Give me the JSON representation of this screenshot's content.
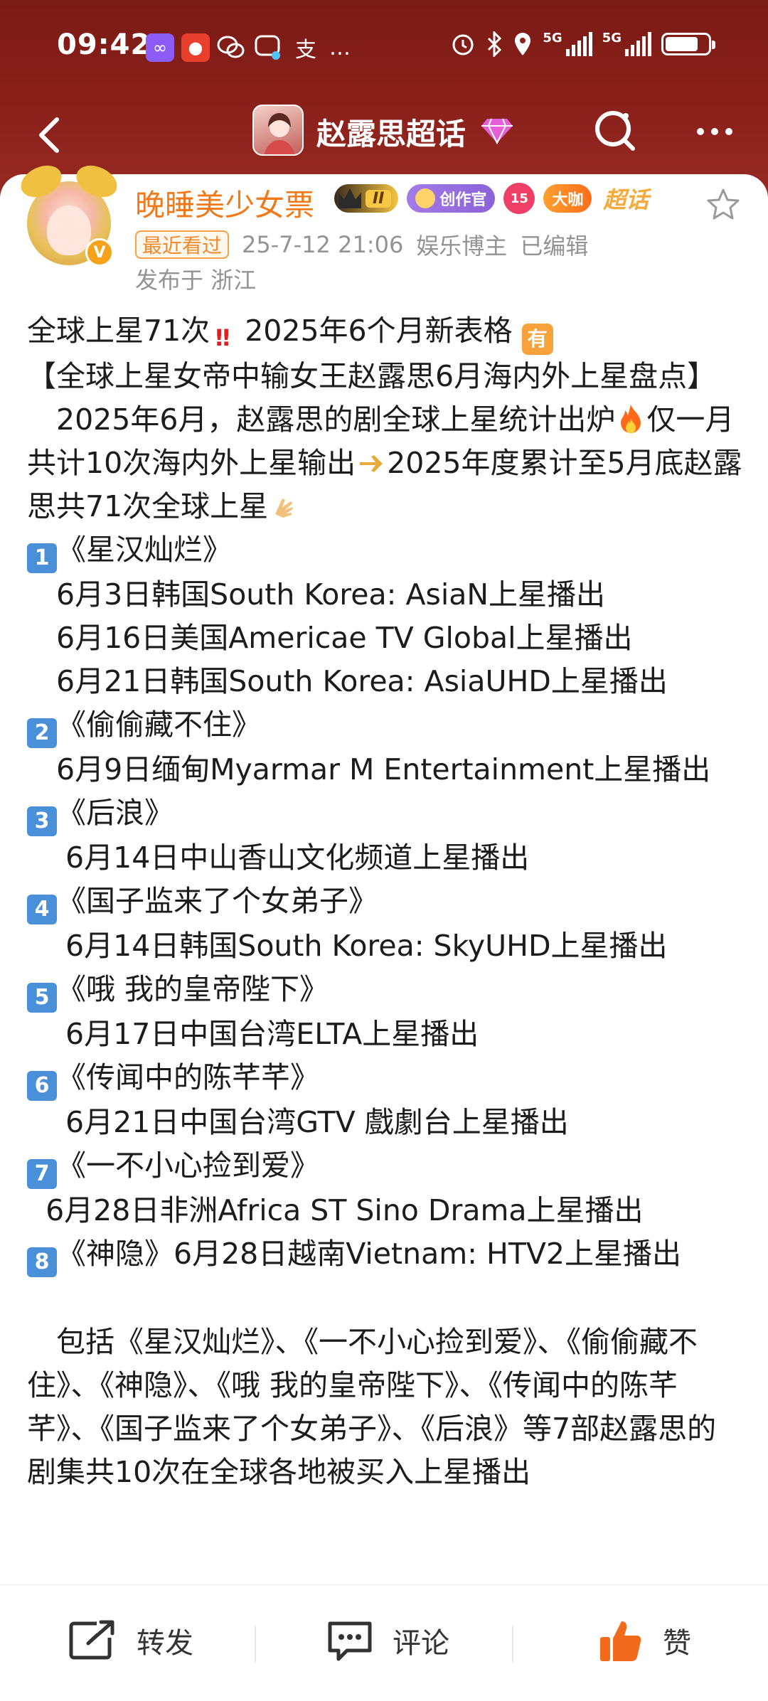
{
  "status_bar": {
    "time": "09:42",
    "signal_1": "5G",
    "signal_2": "5G",
    "battery_level": 0.78
  },
  "nav": {
    "title": "赵露思超话"
  },
  "post": {
    "username": "晚睡美少女票",
    "badges": {
      "rank": "II",
      "creator": "创作官",
      "level": "15",
      "dav": "大咖",
      "super": "超话"
    },
    "recent_tag": "最近看过",
    "timestamp": "25-7-12 21:06",
    "role": "娱乐博主",
    "edited": "已编辑",
    "location": "发布于 浙江",
    "lines": {
      "l1a": "全球上星71次",
      "l1b": " 2025年6个月新表格 ",
      "l2": "【全球上星女帝中输女王赵露思6月海内外上星盘点】",
      "l3a": "　2025年6月，赵露思的剧全球上星统计出炉",
      "l3b": "仅一月共计10次海内外上星输出",
      "l3c": "2025年度累计至5月底赵露思共71次全球上星",
      "s1": "《星汉灿烂》",
      "s1a": "　6月3日韩国South Korea: AsiaN上星播出",
      "s1b": "　6月16日美国Americae TV Global上星播出",
      "s1c": "　6月21日韩国South Korea: AsiaUHD上星播出",
      "s2": "《偷偷藏不住》",
      "s2a": "　6月9日缅甸Myarmar M Entertainment上星播出",
      "s3": "《后浪》",
      "s3a": "　 6月14日中山香山文化频道上星播出",
      "s4": "《国子监来了个女弟子》",
      "s4a": "　 6月14日韩国South Korea: SkyUHD上星播出",
      "s5": "《哦 我的皇帝陛下》",
      "s5a": "　 6月17日中国台湾ELTA上星播出",
      "s6": "《传闻中的陈芊芊》",
      "s6a": "　 6月21日中国台湾GTV 戲劇台上星播出",
      "s7": "《一不小心捡到爱》",
      "s7a": "  6月28日非洲Africa ST Sino Drama上星播出",
      "s8": "《神隐》6月28日越南Vietnam: HTV2上星播出",
      "summary": "　包括《星汉灿烂》、《一不小心捡到爱》、《偷偷藏不住》、《神隐》、《哦 我的皇帝陛下》、《传闻中的陈芊芊》、《国子监来了个女弟子》、《后浪》等7部赵露思的剧集共10次在全球各地被买入上星播出"
    },
    "emoji": {
      "bang": "‼",
      "you": "有",
      "n1": "1",
      "n2": "2",
      "n3": "3",
      "n4": "4",
      "n5": "5",
      "n6": "6",
      "n7": "7",
      "n8": "8"
    }
  },
  "actions": {
    "repost": "转发",
    "comment": "评论",
    "like": "赞"
  },
  "colors": {
    "header": "#8a201a",
    "username": "#f07a1a",
    "meta": "#939393",
    "like": "#f26b1d"
  }
}
